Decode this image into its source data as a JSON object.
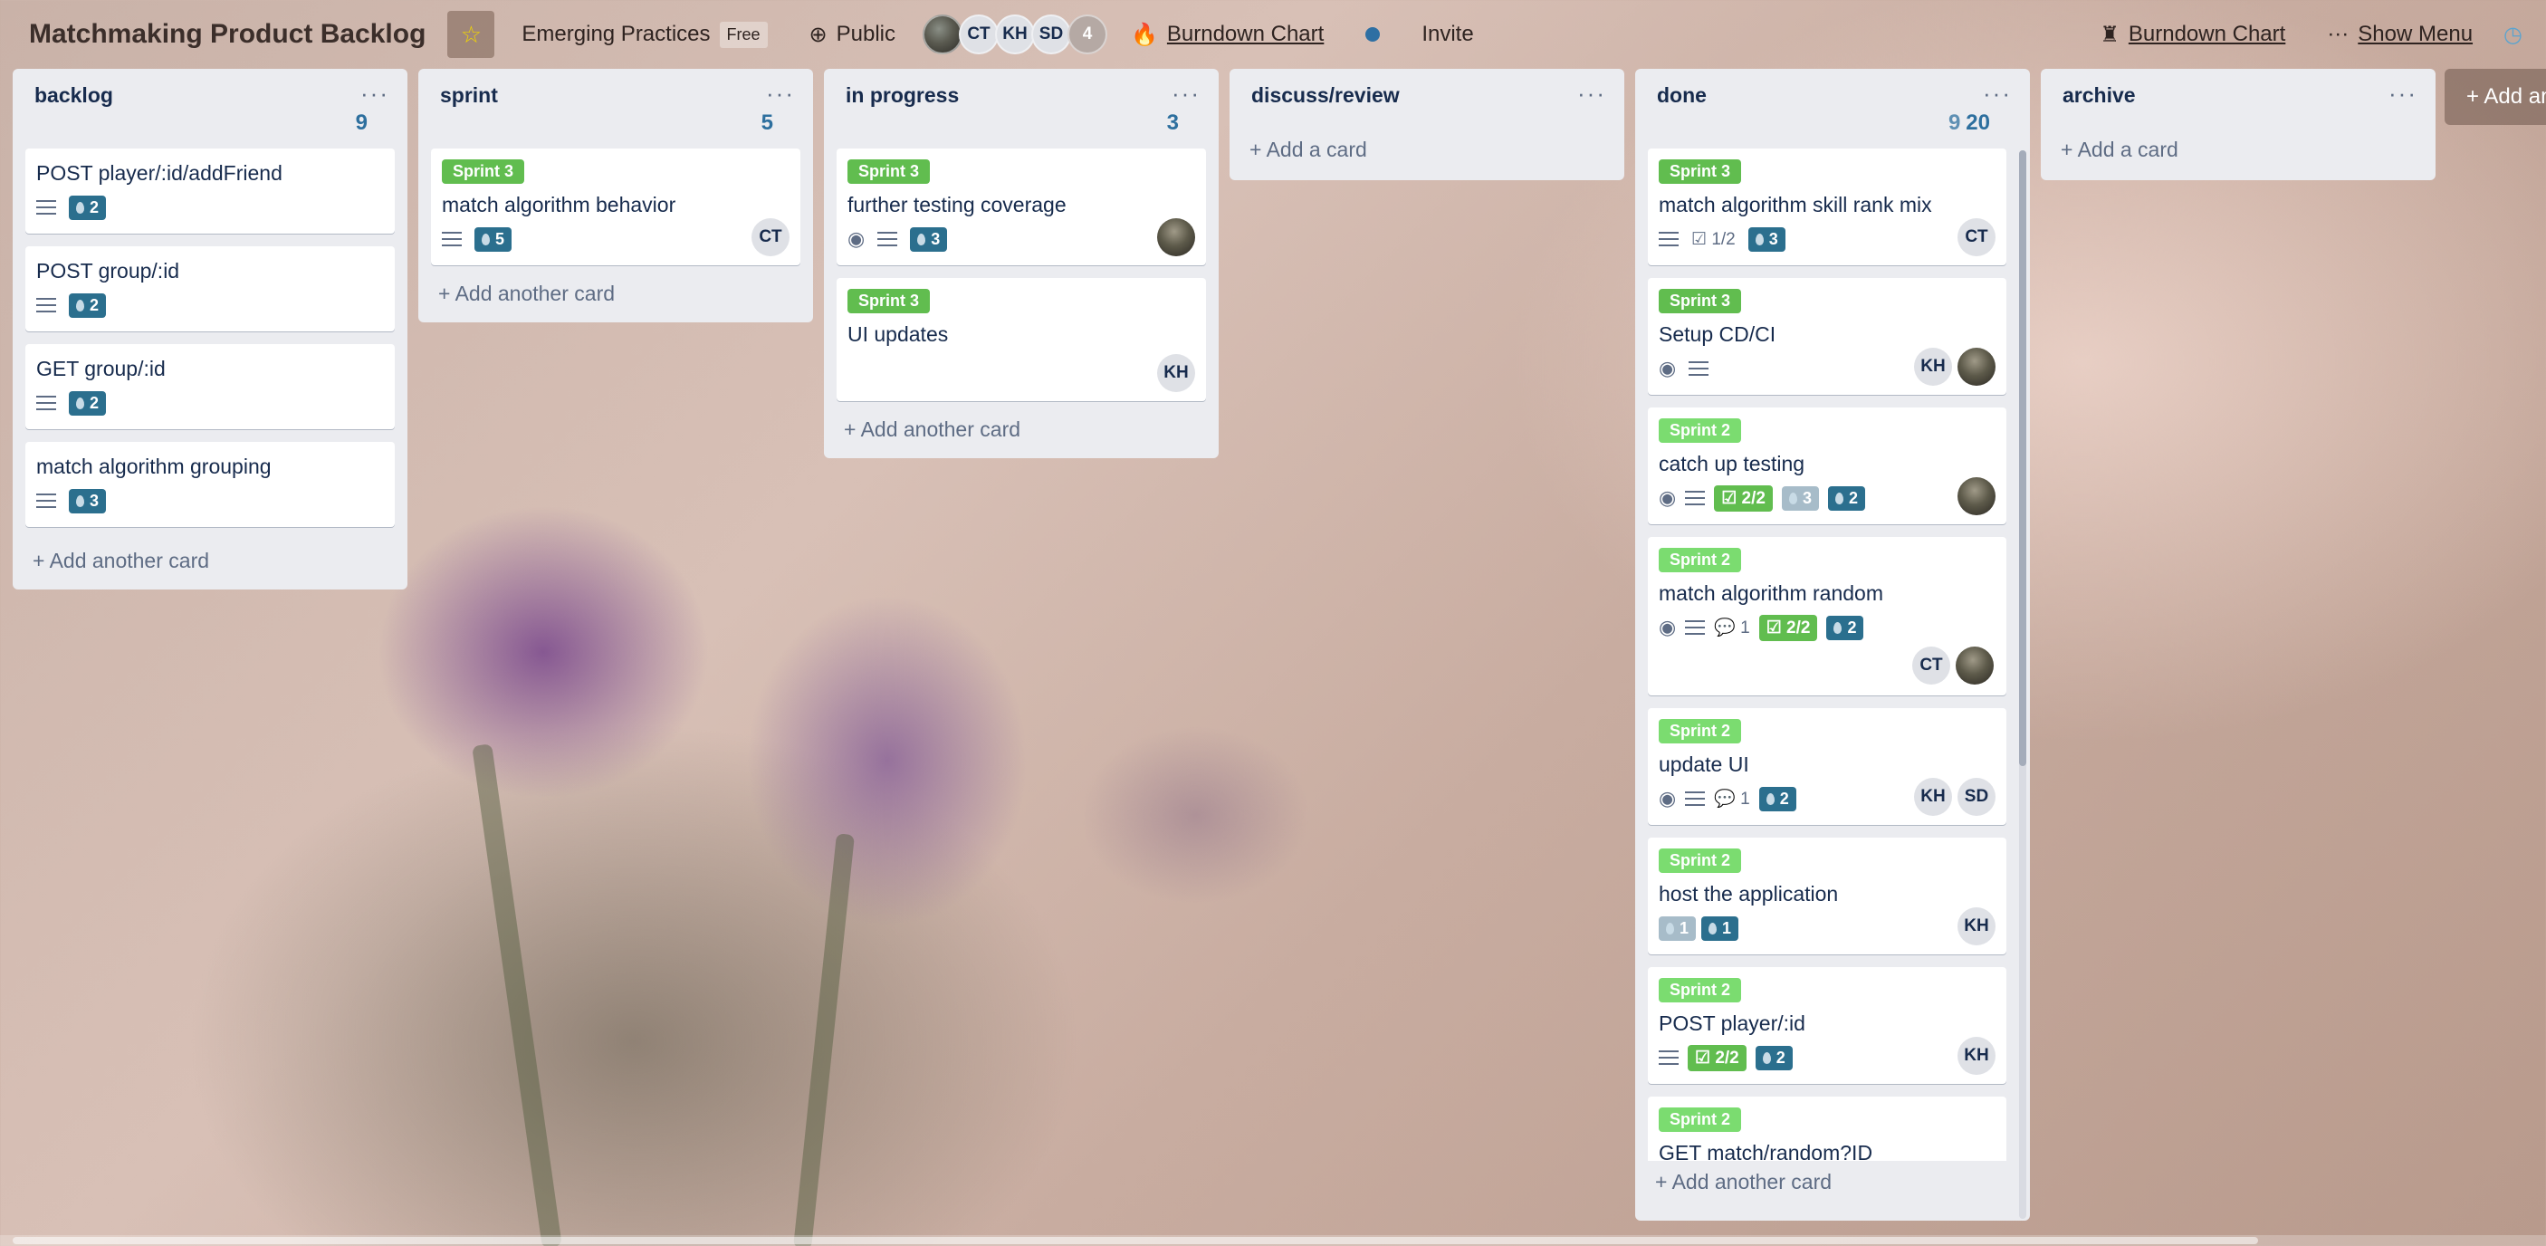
{
  "header": {
    "board_title": "Matchmaking Product Backlog",
    "team_name": "Emerging Practices",
    "team_tag": "Free",
    "visibility": "Public",
    "members": [
      "CT",
      "KH",
      "SD"
    ],
    "extra_members": "4",
    "burndown_left": "Burndown Chart",
    "invite": "Invite",
    "burndown_right": "Burndown Chart",
    "show_menu": "Show Menu"
  },
  "lists": [
    {
      "title": "backlog",
      "count": "9",
      "cards": [
        {
          "title": "POST player/:id/addFriend",
          "points": "2"
        },
        {
          "title": "POST group/:id",
          "points": "2"
        },
        {
          "title": "GET group/:id",
          "points": "2"
        },
        {
          "title": "match algorithm grouping",
          "points": "3"
        }
      ],
      "add": "Add another card"
    },
    {
      "title": "sprint",
      "count": "5",
      "cards": [
        {
          "label": "Sprint 3",
          "title": "match algorithm behavior",
          "points": "5",
          "member": "CT"
        }
      ],
      "add": "Add another card"
    },
    {
      "title": "in progress",
      "count": "3",
      "cards": [
        {
          "label": "Sprint 3",
          "title": "further testing coverage",
          "points": "3"
        },
        {
          "label": "Sprint 3",
          "title": "UI updates",
          "member": "KH"
        }
      ],
      "add": "Add another card"
    },
    {
      "title": "discuss/review",
      "add": "Add a card"
    },
    {
      "title": "done",
      "count_muted": "9",
      "count": "20",
      "cards": [
        {
          "label": "Sprint 3",
          "title": "match algorithm skill rank mix",
          "checklist": "1/2",
          "points": "3",
          "member": "CT"
        },
        {
          "label": "Sprint 3",
          "title": "Setup CD/CI",
          "member": "KH"
        },
        {
          "label": "Sprint 2",
          "title": "catch up testing",
          "checklist": "2/2",
          "points_light": "3",
          "points": "2"
        },
        {
          "label": "Sprint 2",
          "title": "match algorithm random",
          "comments": "1",
          "checklist": "2/2",
          "points": "2",
          "member": "CT"
        },
        {
          "label": "Sprint 2",
          "title": "update UI",
          "comments": "1",
          "points": "2",
          "members": [
            "KH",
            "SD"
          ]
        },
        {
          "label": "Sprint 2",
          "title": "host the application",
          "points_light": "1",
          "points": "1",
          "member": "KH"
        },
        {
          "label": "Sprint 2",
          "title": "POST player/:id",
          "checklist": "2/2",
          "points": "2",
          "member": "KH"
        },
        {
          "label": "Sprint 2",
          "title": "GET match/random?ID"
        }
      ],
      "add": "Add another card"
    },
    {
      "title": "archive",
      "add": "Add a card"
    }
  ],
  "add_list": "+ Add another list",
  "colors": {
    "sprint3": "#61bd4f",
    "sprint2": "#7bdc70",
    "points": "#2b6f8e",
    "list_bg": "#ebecf0"
  }
}
